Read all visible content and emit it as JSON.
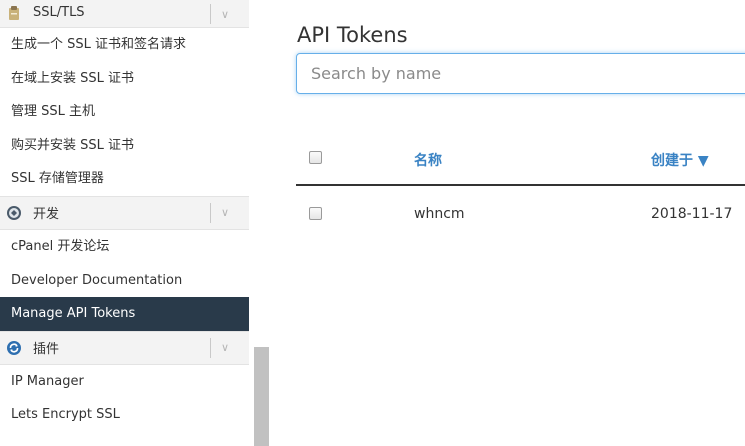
{
  "sidebar": {
    "groups": [
      {
        "title": "SSL/TLS",
        "icon": "ssl-certificate-icon",
        "items": [
          {
            "label": "生成一个 SSL 证书和签名请求"
          },
          {
            "label": "在域上安装 SSL 证书"
          },
          {
            "label": "管理 SSL 主机"
          },
          {
            "label": "购买并安装 SSL 证书"
          },
          {
            "label": "SSL 存储管理器"
          }
        ]
      },
      {
        "title": "开发",
        "icon": "developer-gear-icon",
        "items": [
          {
            "label": "cPanel 开发论坛"
          },
          {
            "label": "Developer Documentation"
          },
          {
            "label": "Manage API Tokens",
            "active": true
          }
        ]
      },
      {
        "title": "插件",
        "icon": "plugin-refresh-icon",
        "items": [
          {
            "label": "IP Manager"
          },
          {
            "label": "Lets Encrypt SSL"
          }
        ]
      }
    ],
    "toggle_glyph": "∨"
  },
  "main": {
    "title": "API Tokens",
    "search": {
      "placeholder": "Search by name",
      "value": ""
    },
    "table": {
      "columns": [
        {
          "label": "名称"
        },
        {
          "label": "创建于 ▼"
        }
      ],
      "rows": [
        {
          "name": "whncm",
          "created": "2018-11-17"
        }
      ]
    }
  },
  "colors": {
    "accent": "#3a83c4",
    "active_nav_bg": "#293a4a",
    "focus_border": "#66afe9"
  }
}
